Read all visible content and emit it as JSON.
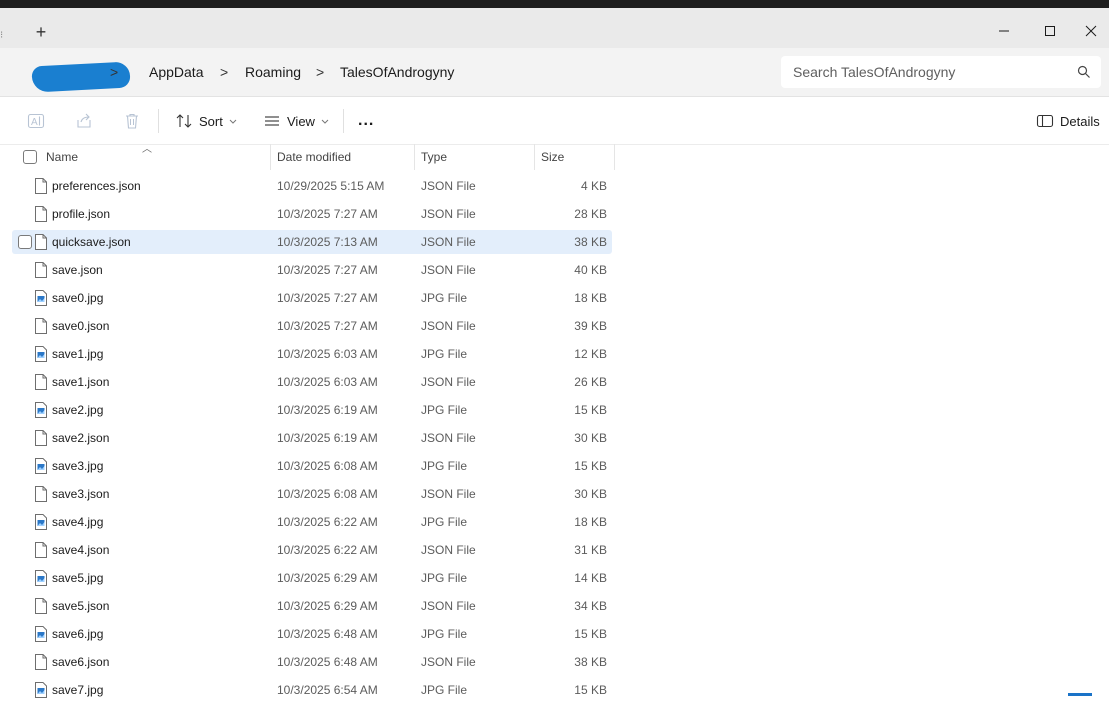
{
  "titlebar": {
    "new_tab_glyph": "+"
  },
  "address": {
    "crumbs": [
      "AppData",
      "Roaming",
      "TalesOfAndrogyny"
    ],
    "separator": ">"
  },
  "search": {
    "placeholder": "Search TalesOfAndrogyny"
  },
  "commands": {
    "sort_label": "Sort",
    "view_label": "View",
    "more_label": "...",
    "details_label": "Details"
  },
  "columns": {
    "name": "Name",
    "date": "Date modified",
    "type": "Type",
    "size": "Size"
  },
  "files": [
    {
      "name": "preferences.json",
      "date": "10/29/2025 5:15 AM",
      "type": "JSON File",
      "size": "4 KB",
      "kind": "doc"
    },
    {
      "name": "profile.json",
      "date": "10/3/2025 7:27 AM",
      "type": "JSON File",
      "size": "28 KB",
      "kind": "doc"
    },
    {
      "name": "quicksave.json",
      "date": "10/3/2025 7:13 AM",
      "type": "JSON File",
      "size": "38 KB",
      "kind": "doc",
      "selected": true
    },
    {
      "name": "save.json",
      "date": "10/3/2025 7:27 AM",
      "type": "JSON File",
      "size": "40 KB",
      "kind": "doc"
    },
    {
      "name": "save0.jpg",
      "date": "10/3/2025 7:27 AM",
      "type": "JPG File",
      "size": "18 KB",
      "kind": "image"
    },
    {
      "name": "save0.json",
      "date": "10/3/2025 7:27 AM",
      "type": "JSON File",
      "size": "39 KB",
      "kind": "doc"
    },
    {
      "name": "save1.jpg",
      "date": "10/3/2025 6:03 AM",
      "type": "JPG File",
      "size": "12 KB",
      "kind": "image"
    },
    {
      "name": "save1.json",
      "date": "10/3/2025 6:03 AM",
      "type": "JSON File",
      "size": "26 KB",
      "kind": "doc"
    },
    {
      "name": "save2.jpg",
      "date": "10/3/2025 6:19 AM",
      "type": "JPG File",
      "size": "15 KB",
      "kind": "image"
    },
    {
      "name": "save2.json",
      "date": "10/3/2025 6:19 AM",
      "type": "JSON File",
      "size": "30 KB",
      "kind": "doc"
    },
    {
      "name": "save3.jpg",
      "date": "10/3/2025 6:08 AM",
      "type": "JPG File",
      "size": "15 KB",
      "kind": "image"
    },
    {
      "name": "save3.json",
      "date": "10/3/2025 6:08 AM",
      "type": "JSON File",
      "size": "30 KB",
      "kind": "doc"
    },
    {
      "name": "save4.jpg",
      "date": "10/3/2025 6:22 AM",
      "type": "JPG File",
      "size": "18 KB",
      "kind": "image"
    },
    {
      "name": "save4.json",
      "date": "10/3/2025 6:22 AM",
      "type": "JSON File",
      "size": "31 KB",
      "kind": "doc"
    },
    {
      "name": "save5.jpg",
      "date": "10/3/2025 6:29 AM",
      "type": "JPG File",
      "size": "14 KB",
      "kind": "image"
    },
    {
      "name": "save5.json",
      "date": "10/3/2025 6:29 AM",
      "type": "JSON File",
      "size": "34 KB",
      "kind": "doc"
    },
    {
      "name": "save6.jpg",
      "date": "10/3/2025 6:48 AM",
      "type": "JPG File",
      "size": "15 KB",
      "kind": "image"
    },
    {
      "name": "save6.json",
      "date": "10/3/2025 6:48 AM",
      "type": "JSON File",
      "size": "38 KB",
      "kind": "doc"
    },
    {
      "name": "save7.jpg",
      "date": "10/3/2025 6:54 AM",
      "type": "JPG File",
      "size": "15 KB",
      "kind": "image"
    }
  ],
  "colors": {
    "selection": "#e3eefb",
    "accent": "#1a73c8",
    "titlebar": "#eaeaea"
  }
}
